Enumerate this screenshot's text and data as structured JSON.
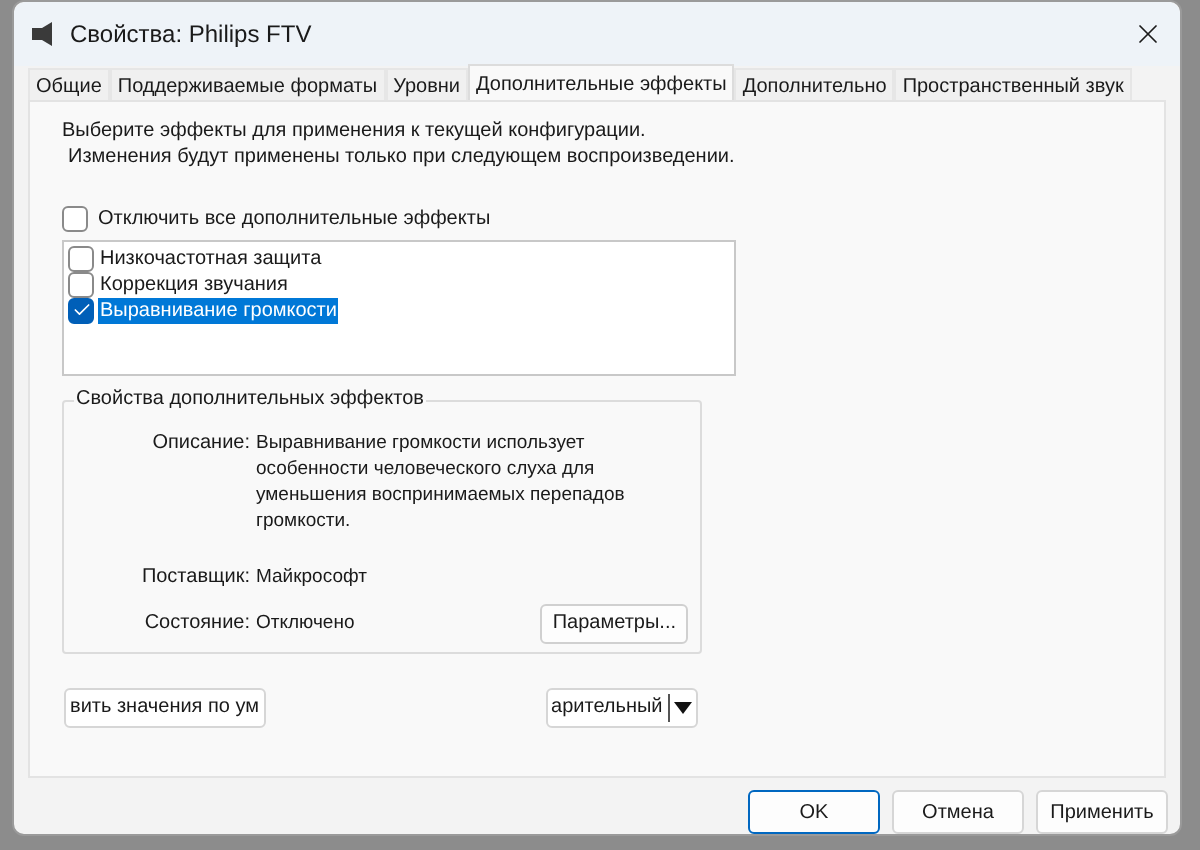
{
  "window": {
    "title": "Свойства: Philips FTV"
  },
  "tabs": [
    {
      "label": "Общие",
      "selected": false
    },
    {
      "label": "Поддерживаемые форматы",
      "selected": false
    },
    {
      "label": "Уровни",
      "selected": false
    },
    {
      "label": "Дополнительные эффекты",
      "selected": true
    },
    {
      "label": "Дополнительно",
      "selected": false
    },
    {
      "label": "Пространственный звук",
      "selected": false
    }
  ],
  "intro": [
    "Выберите эффекты для применения к текущей конфигурации.",
    "Изменения будут применены только при следующем воспроизведении."
  ],
  "disable_all": {
    "label": "Отключить все дополнительные эффекты",
    "checked": false
  },
  "effects": [
    {
      "label": "Низкочастотная защита",
      "checked": false,
      "selected": false
    },
    {
      "label": "Коррекция звучания",
      "checked": false,
      "selected": false
    },
    {
      "label": "Выравнивание громкости",
      "checked": true,
      "selected": true
    }
  ],
  "properties": {
    "title": "Свойства дополнительных эффектов",
    "fields": [
      {
        "label": "Описание:",
        "value": "Выравнивание громкости использует особенности человеческого слуха для уменьшения воспринимаемых перепадов громкости."
      },
      {
        "label": "Поставщик:",
        "value": "Майкрософт"
      },
      {
        "label": "Состояние:",
        "value": "Отключено"
      }
    ],
    "settings_button": "Параметры..."
  },
  "restore_button": "вить значения по ум",
  "mode_dropdown": "арительный",
  "buttons": [
    {
      "label": "OK",
      "default": true
    },
    {
      "label": "Отмена",
      "default": false
    },
    {
      "label": "Применить",
      "default": false
    }
  ]
}
